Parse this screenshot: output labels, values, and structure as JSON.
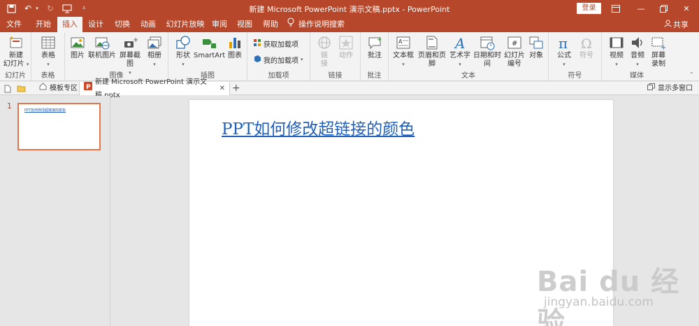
{
  "titlebar": {
    "title": "新建 Microsoft PowerPoint 演示文稿.pptx  -  PowerPoint",
    "login_label": "登录",
    "qat": [
      "save-icon",
      "undo-icon",
      "redo-icon",
      "present-icon",
      "customize-icon"
    ]
  },
  "tabs": {
    "file": "文件",
    "home": "开始",
    "insert": "插入",
    "design": "设计",
    "transitions": "切换",
    "animations": "动画",
    "slideshow": "幻灯片放映",
    "review": "审阅",
    "view": "视图",
    "help": "帮助",
    "tellme": "操作说明搜索",
    "share": "共享",
    "active": "插入"
  },
  "ribbon": {
    "groups": {
      "slides": "幻灯片",
      "tables": "表格",
      "images": "图像",
      "illustrations": "插图",
      "addins": "加载项",
      "links": "链接",
      "comments": "批注",
      "text": "文本",
      "symbols": "符号",
      "media": "媒体"
    },
    "buttons": {
      "new_slide_1": "新建",
      "new_slide_2": "幻灯片",
      "table": "表格",
      "picture": "图片",
      "online_picture": "联机图片",
      "screenshot": "屏幕截图",
      "album": "相册",
      "shapes": "形状",
      "smartart": "SmartArt",
      "chart": "图表",
      "get_addins": "获取加载项",
      "my_addins": "我的加载项",
      "link_1": "链",
      "link_2": "接",
      "action": "动作",
      "comment": "批注",
      "textbox": "文本框",
      "header_footer": "页眉和页脚",
      "wordart": "艺术字",
      "datetime": "日期和时间",
      "slide_number_1": "幻灯片",
      "slide_number_2": "编号",
      "object": "对象",
      "equation": "公式",
      "symbol": "符号",
      "video": "视频",
      "audio": "音频",
      "screen_rec_1": "屏幕",
      "screen_rec_2": "录制"
    }
  },
  "doctabs": {
    "templates": "模板专区",
    "document": "新建 Microsoft PowerPoint 演示文稿.pptx",
    "multi_window": "显示多窗口"
  },
  "thumbnails": [
    {
      "number": "1",
      "title": "PPT如何修改超链接的颜色"
    }
  ],
  "slide": {
    "title": "PPT如何修改超链接的颜色"
  },
  "colors": {
    "accent": "#b7472a",
    "link": "#1f5fbf",
    "thumb_border": "#e8744a"
  },
  "watermark": {
    "logo": "Bai du 经验",
    "url": "jingyan.baidu.com"
  }
}
